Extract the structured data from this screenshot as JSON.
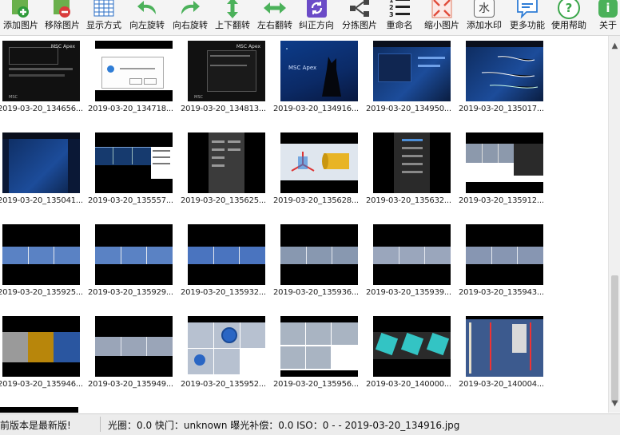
{
  "toolbar": [
    {
      "label": "添加图片",
      "icon": "add-image-icon"
    },
    {
      "label": "移除图片",
      "icon": "remove-image-icon"
    },
    {
      "label": "显示方式",
      "icon": "view-mode-icon"
    },
    {
      "label": "向左旋转",
      "icon": "rotate-left-icon"
    },
    {
      "label": "向右旋转",
      "icon": "rotate-right-icon"
    },
    {
      "label": "上下翻转",
      "icon": "flip-vertical-icon"
    },
    {
      "label": "左右翻转",
      "icon": "flip-horizontal-icon"
    },
    {
      "label": "纠正方向",
      "icon": "correct-orientation-icon"
    },
    {
      "label": "分拣图片",
      "icon": "sort-images-icon"
    },
    {
      "label": "重命名",
      "icon": "rename-icon"
    },
    {
      "label": "缩小图片",
      "icon": "shrink-image-icon"
    },
    {
      "label": "添加水印",
      "icon": "watermark-icon"
    },
    {
      "label": "更多功能",
      "icon": "more-features-icon"
    },
    {
      "label": "使用帮助",
      "icon": "help-icon"
    },
    {
      "label": "关于",
      "icon": "about-icon"
    }
  ],
  "watermark_glyph": "水",
  "help_glyph": "?",
  "about_glyph": "i",
  "rename_digits": [
    "1",
    "2",
    "3"
  ],
  "thumbnails": [
    "2019-03-20_134656...",
    "2019-03-20_134718...",
    "2019-03-20_134813...",
    "2019-03-20_134916...",
    "2019-03-20_134950...",
    "2019-03-20_135017...",
    "2019-03-20_135041...",
    "2019-03-20_135557...",
    "2019-03-20_135625...",
    "2019-03-20_135628...",
    "2019-03-20_135632...",
    "2019-03-20_135912...",
    "2019-03-20_135925...",
    "2019-03-20_135929...",
    "2019-03-20_135932...",
    "2019-03-20_135936...",
    "2019-03-20_135939...",
    "2019-03-20_135943...",
    "2019-03-20_135946...",
    "2019-03-20_135949...",
    "2019-03-20_135952...",
    "2019-03-20_135956...",
    "2019-03-20_140000...",
    "2019-03-20_140004..."
  ],
  "thumb_text": {
    "brand": "MSC Apex",
    "msc": "MSC",
    "apex": "Apex"
  },
  "status": {
    "version": "前版本是最新版!",
    "info": "光圈：0.0 快门：unknown 曝光补偿：0.0 ISO：0 -  - 2019-03-20_134916.jpg"
  },
  "colors": {
    "toolbar_bg": "#f4f4f4",
    "green": "#3aa64a",
    "blue": "#2f7dd6",
    "purple": "#6b4bc7"
  }
}
